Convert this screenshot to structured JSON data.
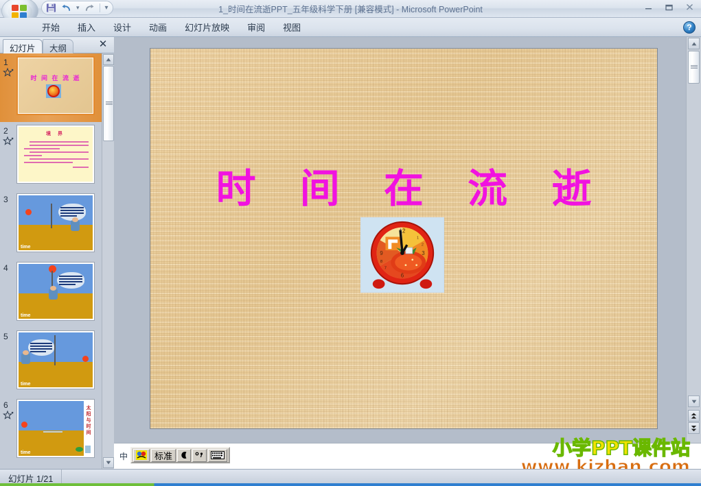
{
  "window": {
    "title": "1_时间在流逝PPT_五年级科学下册 [兼容模式] - Microsoft PowerPoint",
    "minimize_label": "—",
    "restore_label": "❐",
    "close_label": "✕",
    "help_label": "?"
  },
  "quick_access": {
    "save_label": "save-icon",
    "undo_label": "undo-icon",
    "undo_dropdown_label": "▾",
    "redo_label": "redo-icon",
    "customize_label": "▾"
  },
  "ribbon": {
    "tabs": [
      {
        "label": "开始"
      },
      {
        "label": "插入"
      },
      {
        "label": "设计"
      },
      {
        "label": "动画"
      },
      {
        "label": "幻灯片放映"
      },
      {
        "label": "审阅"
      },
      {
        "label": "视图"
      }
    ]
  },
  "left_panel": {
    "tabs": [
      {
        "label": "幻灯片",
        "active": true
      },
      {
        "label": "大纲",
        "active": false
      }
    ],
    "close_label": "✕",
    "thumbnails": [
      {
        "number": "1",
        "selected": true,
        "has_animation": true,
        "kind": "title",
        "title": "时 间 在 流 逝"
      },
      {
        "number": "2",
        "selected": false,
        "has_animation": true,
        "kind": "text",
        "title": "境  界"
      },
      {
        "number": "3",
        "selected": false,
        "has_animation": false,
        "kind": "scene-a",
        "caption": "time"
      },
      {
        "number": "4",
        "selected": false,
        "has_animation": false,
        "kind": "scene-b",
        "caption": "time"
      },
      {
        "number": "5",
        "selected": false,
        "has_animation": false,
        "kind": "scene-c",
        "caption": "time"
      },
      {
        "number": "6",
        "selected": false,
        "has_animation": true,
        "kind": "scene-d",
        "caption": "time",
        "side_text": "太阳与时间"
      }
    ]
  },
  "slide": {
    "title": "时 间 在 流 逝",
    "title_color": "#f112e0",
    "background_color": "#e6c893",
    "image_name": "red-alarm-clock-photo"
  },
  "ime_toolbar": {
    "prefix": "中",
    "mode_label": "标准",
    "icons": [
      "ime-logo-icon",
      "half-moon-icon",
      "punctuation-icon",
      "soft-keyboard-icon"
    ]
  },
  "watermark": {
    "line1": "小学PPT课件站",
    "line2": "www.kjzhan.com",
    "line1_color": "#f2e200",
    "line2_color": "#d86e12"
  },
  "status_bar": {
    "slide_counter": "幻灯片 1/21"
  },
  "scrollbars": {
    "up_label": "▲",
    "down_label": "▼",
    "prev_slide_label": "▲▲",
    "next_slide_label": "▼▼"
  }
}
